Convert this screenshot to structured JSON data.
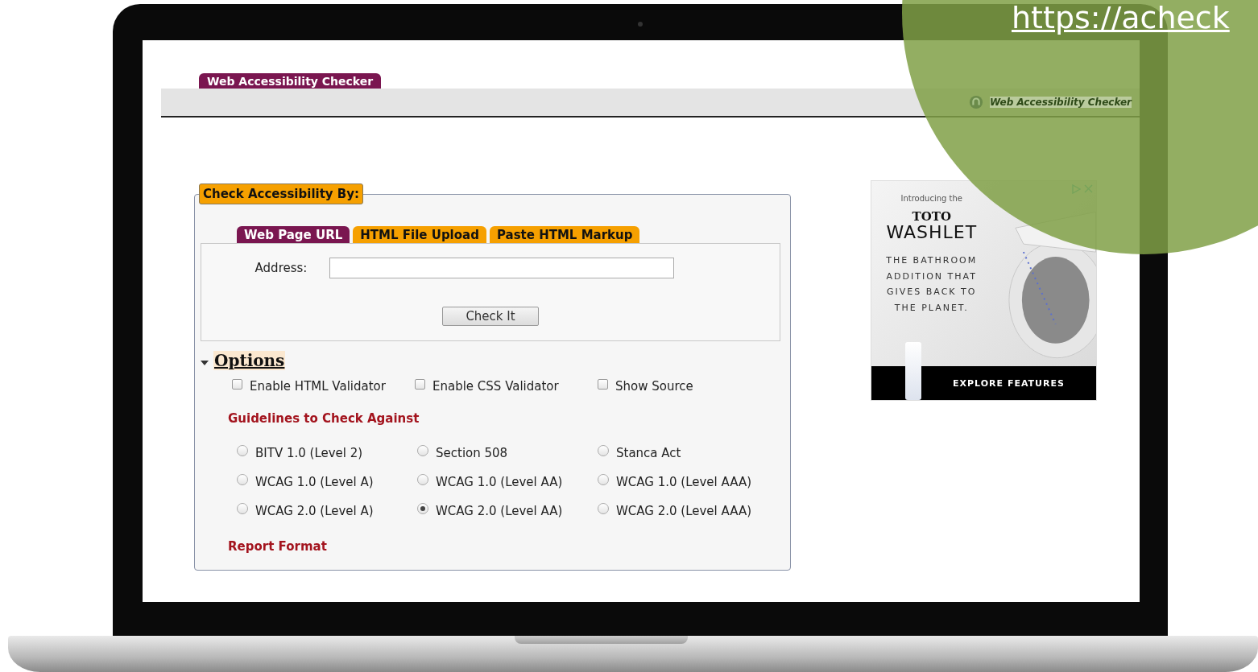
{
  "header": {
    "title": "Web Accessibility Checker",
    "brand": "Web Accessibility Checker"
  },
  "form": {
    "legend": "Check Accessibility By:",
    "tabs": [
      {
        "label": "Web Page URL",
        "selected": true
      },
      {
        "label": "HTML File Upload",
        "selected": false
      },
      {
        "label": "Paste HTML Markup",
        "selected": false
      }
    ],
    "address_label": "Address:",
    "check_button": "Check It"
  },
  "options": {
    "title": "Options",
    "expanded": true,
    "checkboxes": [
      {
        "label": "Enable HTML Validator",
        "checked": false
      },
      {
        "label": "Enable CSS Validator",
        "checked": false
      },
      {
        "label": "Show Source",
        "checked": false
      }
    ],
    "guidelines_title": "Guidelines to Check Against",
    "guidelines": [
      {
        "label": "BITV 1.0 (Level 2)",
        "selected": false
      },
      {
        "label": "Section 508",
        "selected": false
      },
      {
        "label": "Stanca Act",
        "selected": false
      },
      {
        "label": "WCAG 1.0 (Level A)",
        "selected": false
      },
      {
        "label": "WCAG 1.0 (Level AA)",
        "selected": false
      },
      {
        "label": "WCAG 1.0 (Level AAA)",
        "selected": false
      },
      {
        "label": "WCAG 2.0 (Level A)",
        "selected": false
      },
      {
        "label": "WCAG 2.0 (Level AA)",
        "selected": true
      },
      {
        "label": "WCAG 2.0 (Level AAA)",
        "selected": false
      }
    ],
    "report_title": "Report Format"
  },
  "ad": {
    "intro": "Introducing the",
    "brand": "TOTO",
    "product": "WASHLET",
    "tagline": "THE BATHROOM ADDITION THAT GIVES BACK TO THE PLANET.",
    "cta": "EXPLORE FEATURES"
  },
  "overlay": {
    "url": "https://acheck"
  }
}
